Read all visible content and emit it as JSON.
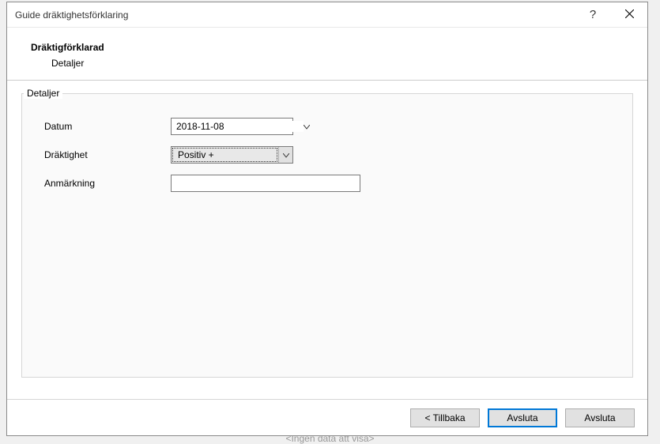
{
  "window": {
    "title": "Guide dräktighetsförklaring"
  },
  "wizard": {
    "title": "Dräktigförklarad",
    "subtitle": "Detaljer"
  },
  "group": {
    "title": "Detaljer"
  },
  "form": {
    "date_label": "Datum",
    "date_value": "2018-11-08",
    "pregnancy_label": "Dräktighet",
    "pregnancy_value": "Positiv +",
    "note_label": "Anmärkning",
    "note_value": ""
  },
  "footer": {
    "back": "< Tillbaka",
    "finish": "Avsluta",
    "cancel": "Avsluta"
  },
  "background": {
    "hidden_text": "<Ingen data att visa>"
  }
}
